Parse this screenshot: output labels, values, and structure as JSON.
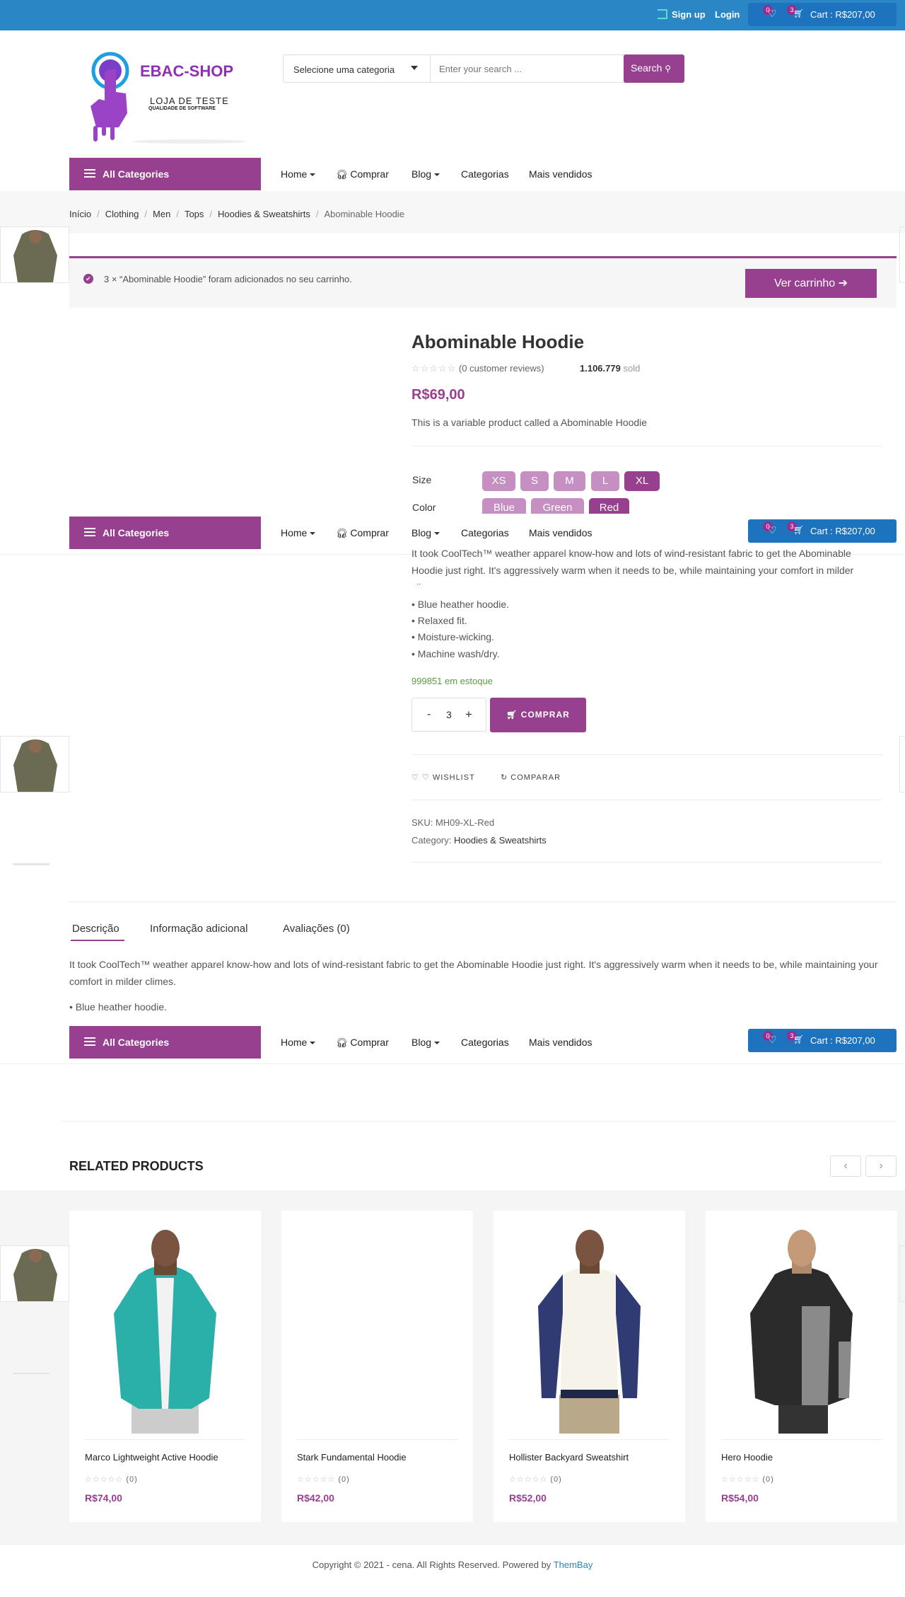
{
  "topbar": {
    "signup": "Sign up",
    "login": "Login",
    "wishlist_count": "0",
    "cart_count": "3",
    "cart_label": "Cart : R$207,00"
  },
  "header": {
    "logo_title": "EBAC-SHOP",
    "logo_line1": "LOJA DE TESTE",
    "logo_line2": "QUALIDADE DE SOFTWARE",
    "category_select": "Selecione uma categoria",
    "search_placeholder": "Enter your search ...",
    "search_button": "Search"
  },
  "nav": {
    "all_categories": "All Categories",
    "home": "Home",
    "comprar": "Comprar",
    "blog": "Blog",
    "categorias": "Categorias",
    "mais_vendidos": "Mais vendidos"
  },
  "breadcrumb": [
    "Início",
    "Clothing",
    "Men",
    "Tops",
    "Hoodies & Sweatshirts",
    "Abominable Hoodie"
  ],
  "notice": {
    "text": "3 × “Abominable Hoodie” foram adicionados no seu carrinho.",
    "button": "Ver carrinho"
  },
  "product": {
    "title": "Abominable Hoodie",
    "reviews": "(0 customer reviews)",
    "sold_count": "1.106.779",
    "sold_label": "sold",
    "price": "R$69,00",
    "short_desc": "This is a variable product called a Abominable Hoodie",
    "size_label": "Size",
    "sizes": [
      "XS",
      "S",
      "M",
      "L",
      "XL"
    ],
    "selected_size": "XL",
    "color_label": "Color",
    "colors": [
      "Blue",
      "Green",
      "Red"
    ],
    "selected_color": "Red",
    "long_desc": "It took CoolTech™ weather apparel know-how and lots of wind-resistant fabric to get the Abominable Hoodie just right. It's aggressively warm when it needs to be, while maintaining your comfort in milder climes.",
    "bullets": [
      "• Blue heather hoodie.",
      "• Relaxed fit.",
      "• Moisture-wicking.",
      "• Machine wash/dry."
    ],
    "stock": "999851 em estoque",
    "qty": "3",
    "qty_minus": "-",
    "qty_plus": "+",
    "buy": "COMPRAR",
    "wishlist": "WISHLIST",
    "compare": "COMPARAR",
    "sku_label": "SKU:",
    "sku": "MH09-XL-Red",
    "category_label": "Category:",
    "category": "Hoodies & Sweatshirts"
  },
  "tabs": {
    "descricao": "Descrição",
    "info": "Informação adicional",
    "avaliacoes": "Avaliações (0)"
  },
  "tab_content": {
    "text": "It took CoolTech™ weather apparel know-how and lots of wind-resistant fabric to get the Abominable Hoodie just right. It's aggressively warm when it needs to be, while maintaining your comfort in milder climes.",
    "bullet": "• Blue heather hoodie."
  },
  "related": {
    "title": "RELATED PRODUCTS",
    "items": [
      {
        "name": "Marco Lightweight Active Hoodie",
        "count": "(0)",
        "price": "R$74,00"
      },
      {
        "name": "Stark Fundamental Hoodie",
        "count": "(0)",
        "price": "R$42,00"
      },
      {
        "name": "Hollister Backyard Sweatshirt",
        "count": "(0)",
        "price": "R$52,00"
      },
      {
        "name": "Hero Hoodie",
        "count": "(0)",
        "price": "R$54,00"
      }
    ]
  },
  "footer": {
    "text": "Copyright © 2021 - cena. All Rights Reserved. Powered by",
    "link": "ThemBay"
  },
  "colors": {
    "primary": "#96408f",
    "topbar": "#2b86c5",
    "cart": "#1e73be"
  }
}
